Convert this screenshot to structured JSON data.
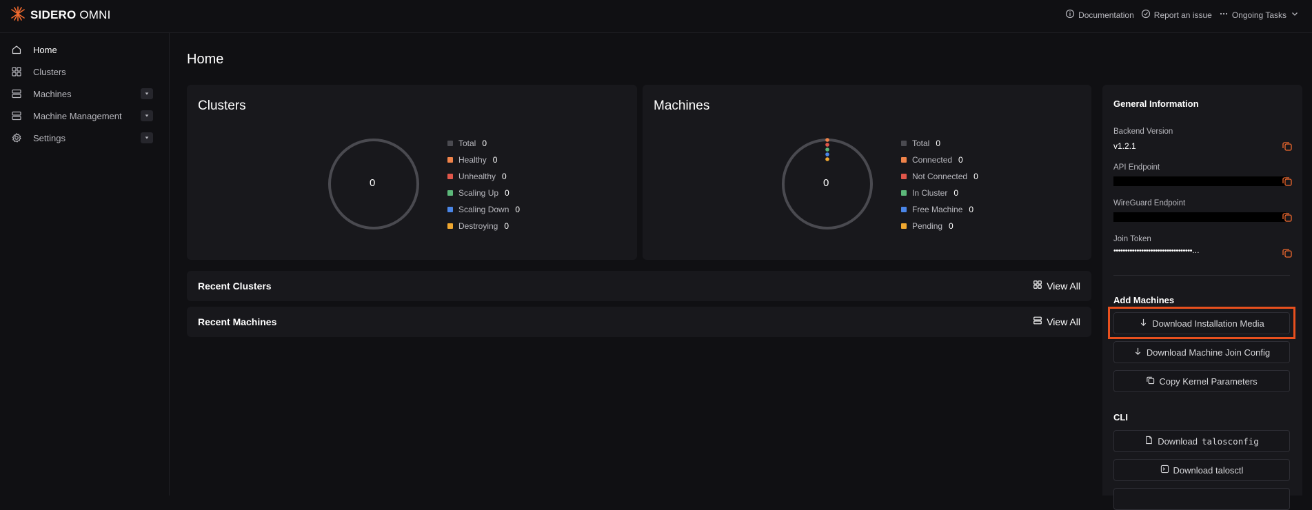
{
  "app": {
    "logo_bold": "SIDERO",
    "logo_light": "OMNI",
    "accent": "#f26a2e"
  },
  "topbar": {
    "documentation": "Documentation",
    "report_issue": "Report an issue",
    "ongoing_tasks": "Ongoing Tasks"
  },
  "sidebar": {
    "items": [
      {
        "label": "Home",
        "icon": "home-icon",
        "dropdown": false
      },
      {
        "label": "Clusters",
        "icon": "grid-icon",
        "dropdown": false
      },
      {
        "label": "Machines",
        "icon": "server-icon",
        "dropdown": true
      },
      {
        "label": "Machine Management",
        "icon": "server-icon",
        "dropdown": true
      },
      {
        "label": "Settings",
        "icon": "gear-icon",
        "dropdown": true
      }
    ]
  },
  "page": {
    "title": "Home"
  },
  "clusters_card": {
    "title": "Clusters",
    "total": "0",
    "legend": [
      {
        "label": "Total",
        "value": "0",
        "color": "#4a4a50"
      },
      {
        "label": "Healthy",
        "value": "0",
        "color": "#f0834a"
      },
      {
        "label": "Unhealthy",
        "value": "0",
        "color": "#e0564a"
      },
      {
        "label": "Scaling Up",
        "value": "0",
        "color": "#5cb87a"
      },
      {
        "label": "Scaling Down",
        "value": "0",
        "color": "#4a86e8"
      },
      {
        "label": "Destroying",
        "value": "0",
        "color": "#f0a830"
      }
    ]
  },
  "machines_card": {
    "title": "Machines",
    "total": "0",
    "legend": [
      {
        "label": "Total",
        "value": "0",
        "color": "#4a4a50"
      },
      {
        "label": "Connected",
        "value": "0",
        "color": "#f0834a"
      },
      {
        "label": "Not Connected",
        "value": "0",
        "color": "#e0564a"
      },
      {
        "label": "In Cluster",
        "value": "0",
        "color": "#5cb87a"
      },
      {
        "label": "Free Machine",
        "value": "0",
        "color": "#4a86e8"
      },
      {
        "label": "Pending",
        "value": "0",
        "color": "#f0a830"
      }
    ]
  },
  "recent": {
    "clusters_title": "Recent Clusters",
    "machines_title": "Recent Machines",
    "view_all": "View All"
  },
  "general_info": {
    "title": "General Information",
    "backend_version_label": "Backend Version",
    "backend_version": "v1.2.1",
    "api_endpoint_label": "API Endpoint",
    "wireguard_endpoint_label": "WireGuard Endpoint",
    "join_token_label": "Join Token",
    "join_token_masked": "••••••••••••••••••••••••••••••••••…"
  },
  "add_machines": {
    "title": "Add Machines",
    "download_media": "Download Installation Media",
    "download_join_config": "Download Machine Join Config",
    "copy_kernel_params": "Copy Kernel Parameters"
  },
  "cli": {
    "title": "CLI",
    "download_prefix": "Download",
    "talosconfig": "talosconfig",
    "download_talosctl": "Download talosctl"
  }
}
